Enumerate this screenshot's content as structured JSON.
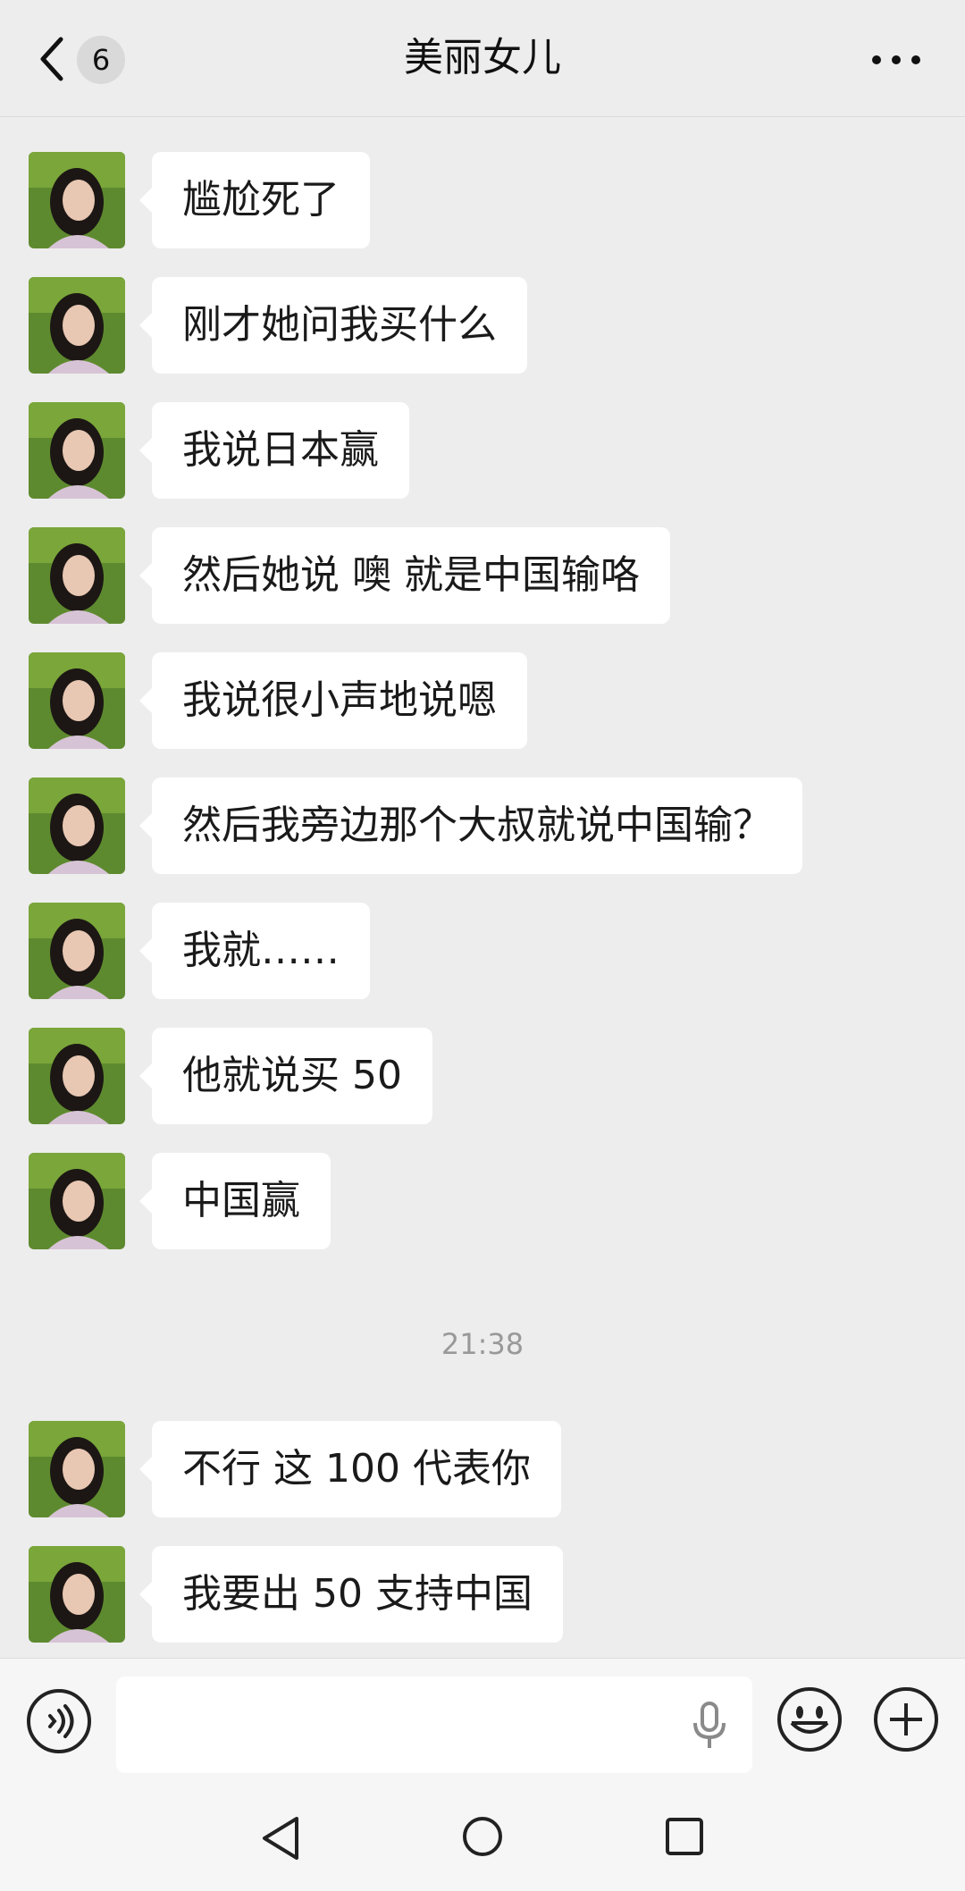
{
  "header": {
    "title": "美丽女儿",
    "unread_count": "6",
    "back_icon": "chevron-left-icon",
    "more_icon": "more-dots-icon"
  },
  "messages": [
    {
      "text": "尴尬死了"
    },
    {
      "text": "刚才她问我买什么"
    },
    {
      "text": "我说日本赢"
    },
    {
      "text": "然后她说 噢 就是中国输咯"
    },
    {
      "text": "我说很小声地说嗯"
    },
    {
      "text": "然后我旁边那个大叔就说中国输？"
    },
    {
      "text": "我就……"
    },
    {
      "text": "他就说买 50"
    },
    {
      "text": "中国赢"
    },
    {
      "text": "不行 这 100 代表你"
    },
    {
      "text": "我要出 50 支持中国"
    }
  ],
  "timestamp": "21:38",
  "input_bar": {
    "voice_icon": "voice-icon",
    "input_value": "",
    "mic_icon": "microphone-icon",
    "emoji_icon": "emoji-icon",
    "plus_icon": "plus-circle-icon"
  },
  "nav_bar": {
    "back_icon": "nav-back-triangle-icon",
    "home_icon": "nav-home-circle-icon",
    "recent_icon": "nav-recent-square-icon"
  },
  "colors": {
    "background": "#ededed",
    "bubble": "#ffffff",
    "timestamp": "#999999"
  }
}
